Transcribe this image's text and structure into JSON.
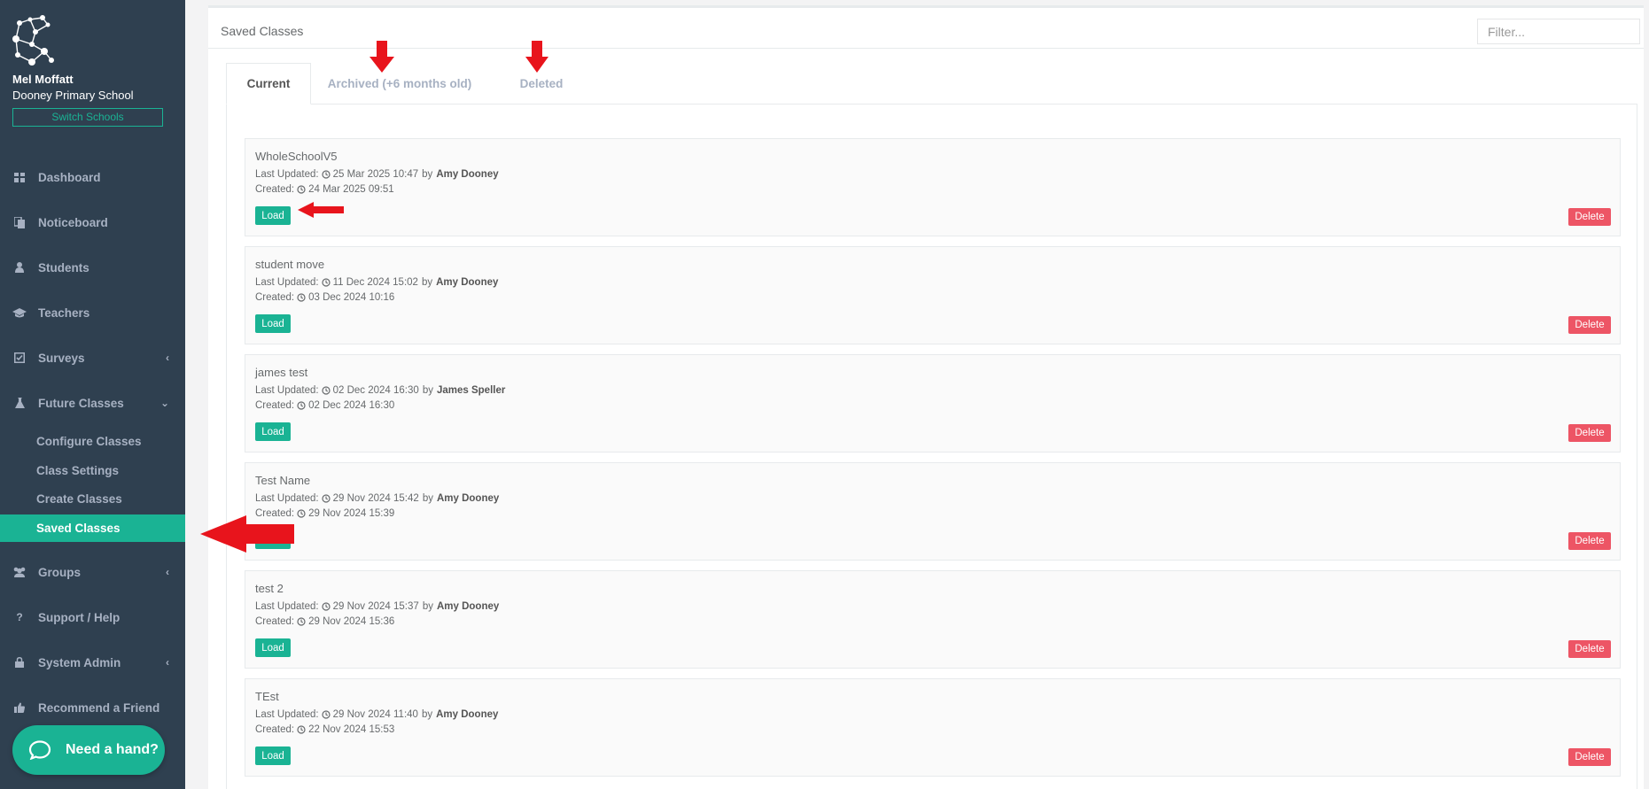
{
  "colors": {
    "sidebar_bg": "#2f4050",
    "accent": "#1ab394",
    "danger": "#ed5565",
    "annotation_arrow": "#e8141c"
  },
  "sidebar": {
    "user_name": "Mel Moffatt",
    "school_name": "Dooney Primary School",
    "switch_label": "Switch Schools",
    "nav": [
      {
        "label": "Dashboard",
        "icon": "dashboard-icon"
      },
      {
        "label": "Noticeboard",
        "icon": "noticeboard-icon"
      },
      {
        "label": "Students",
        "icon": "user-icon"
      },
      {
        "label": "Teachers",
        "icon": "graduation-cap-icon"
      },
      {
        "label": "Surveys",
        "icon": "check-square-icon"
      },
      {
        "label": "Future Classes",
        "icon": "flask-icon"
      },
      {
        "label": "Groups",
        "icon": "users-icon"
      },
      {
        "label": "Support / Help",
        "icon": "question-icon"
      },
      {
        "label": "System Admin",
        "icon": "lock-icon"
      },
      {
        "label": "Recommend a Friend",
        "icon": "thumbs-up-icon"
      }
    ],
    "sub_nav": [
      {
        "label": "Configure Classes"
      },
      {
        "label": "Class Settings"
      },
      {
        "label": "Create Classes"
      },
      {
        "label": "Saved Classes",
        "active": true
      }
    ],
    "help_label": "Need a hand?"
  },
  "panel": {
    "title": "Saved Classes",
    "filter_placeholder": "Filter...",
    "tabs": [
      {
        "label": "Current",
        "active": true
      },
      {
        "label": "Archived (+6 months old)"
      },
      {
        "label": "Deleted"
      }
    ]
  },
  "labels": {
    "last_updated": "Last Updated:",
    "created": "Created:",
    "by": "by",
    "load": "Load",
    "delete": "Delete"
  },
  "saved_classes": [
    {
      "name": "WholeSchoolV5",
      "updated": "25 Mar 2025 10:47",
      "updated_by": "Amy Dooney",
      "created": "24 Mar 2025 09:51"
    },
    {
      "name": "student move",
      "updated": "11 Dec 2024 15:02",
      "updated_by": "Amy Dooney",
      "created": "03 Dec 2024 10:16"
    },
    {
      "name": "james test",
      "updated": "02 Dec 2024 16:30",
      "updated_by": "James Speller",
      "created": "02 Dec 2024 16:30"
    },
    {
      "name": "Test Name",
      "updated": "29 Nov 2024 15:42",
      "updated_by": "Amy Dooney",
      "created": "29 Nov 2024 15:39"
    },
    {
      "name": "test 2",
      "updated": "29 Nov 2024 15:37",
      "updated_by": "Amy Dooney",
      "created": "29 Nov 2024 15:36"
    },
    {
      "name": "TEst",
      "updated": "29 Nov 2024 11:40",
      "updated_by": "Amy Dooney",
      "created": "22 Nov 2024 15:53"
    }
  ]
}
